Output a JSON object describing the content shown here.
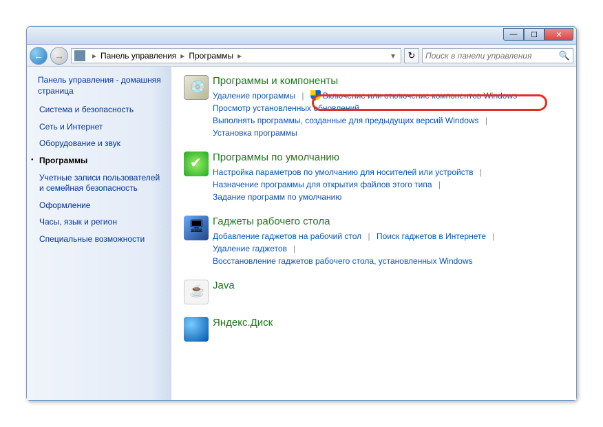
{
  "breadcrumb": {
    "root": "Панель управления",
    "current": "Программы"
  },
  "search": {
    "placeholder": "Поиск в панели управления"
  },
  "sidebar": {
    "home": "Панель управления - домашняя страница",
    "items": [
      "Система и безопасность",
      "Сеть и Интернет",
      "Оборудование и звук",
      "Программы",
      "Учетные записи пользователей и семейная безопасность",
      "Оформление",
      "Часы, язык и регион",
      "Специальные возможности"
    ]
  },
  "sections": {
    "programs": {
      "title": "Программы и компоненты",
      "l1": "Удаление программы",
      "l2": "Включение или отключение компонентов Windows",
      "l3": "Просмотр установленных обновлений",
      "l4": "Выполнять программы, созданные для предыдущих версий Windows",
      "l5": "Установка программы"
    },
    "defaults": {
      "title": "Программы по умолчанию",
      "l1": "Настройка параметров по умолчанию для носителей или устройств",
      "l2": "Назначение программы для открытия файлов этого типа",
      "l3": "Задание программ по умолчанию"
    },
    "gadgets": {
      "title": "Гаджеты рабочего стола",
      "l1": "Добавление гаджетов на рабочий стол",
      "l2": "Поиск гаджетов в Интернете",
      "l3": "Удаление гаджетов",
      "l4": "Восстановление гаджетов рабочего стола, установленных Windows"
    },
    "java": {
      "title": "Java"
    },
    "yandex": {
      "title": "Яндекс.Диск"
    }
  }
}
